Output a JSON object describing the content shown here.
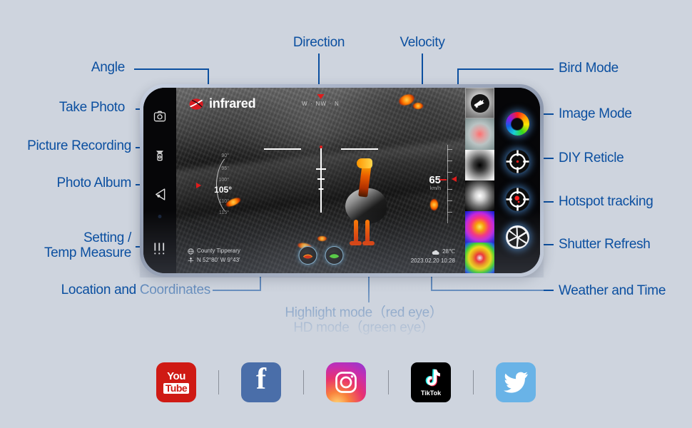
{
  "background_color": "#ced4de",
  "accent_color": "#0b4fa0",
  "annotations": {
    "left": [
      {
        "id": "angle",
        "label": "Angle"
      },
      {
        "id": "take-photo",
        "label": "Take Photo"
      },
      {
        "id": "picture-recording",
        "label": "Picture Recording"
      },
      {
        "id": "photo-album",
        "label": "Photo Album"
      },
      {
        "id": "setting-temp-line1",
        "label": "Setting /"
      },
      {
        "id": "setting-temp-line2",
        "label": "Temp Measure"
      },
      {
        "id": "location-coordinates",
        "label": "Location and Coordinates"
      }
    ],
    "top": [
      {
        "id": "direction",
        "label": "Direction"
      },
      {
        "id": "velocity",
        "label": "Velocity"
      }
    ],
    "right": [
      {
        "id": "bird-mode",
        "label": "Bird Mode"
      },
      {
        "id": "image-mode",
        "label": "Image Mode"
      },
      {
        "id": "diy-reticle",
        "label": "DIY Reticle"
      },
      {
        "id": "hotspot-tracking",
        "label": "Hotspot tracking"
      },
      {
        "id": "shutter-refresh",
        "label": "Shutter Refresh"
      },
      {
        "id": "weather-time",
        "label": "Weather and Time"
      }
    ],
    "bottom": [
      {
        "id": "highlight-mode",
        "label": "Highlight mode（red eye）"
      },
      {
        "id": "hd-mode",
        "label": "HD mode（green eye）"
      }
    ]
  },
  "screen": {
    "brand": "infrared",
    "compass": {
      "west": "W",
      "separator": "·",
      "current": "NW",
      "north": "N",
      "text": "W · NW · N"
    },
    "angle": {
      "ticks": [
        "90°",
        "95°",
        "100°",
        "110°",
        "115°"
      ],
      "current": "105°"
    },
    "velocity": {
      "value": "65",
      "unit": "km/h"
    },
    "location": {
      "place": "County Tipperary",
      "coordinates": "N 52°80′  W 9°43′"
    },
    "weather": {
      "temperature": "28℃",
      "datetime": "2023.02.20  10:28"
    },
    "left_buttons": [
      {
        "id": "take-photo",
        "icon": "camera-icon"
      },
      {
        "id": "picture-recording",
        "icon": "video-record-icon"
      },
      {
        "id": "photo-album",
        "icon": "photo-album-icon"
      },
      {
        "id": "setting-temp",
        "icon": "sliders-icon"
      }
    ],
    "right_buttons": [
      {
        "id": "image-mode",
        "icon": "color-wheel-icon"
      },
      {
        "id": "diy-reticle",
        "icon": "reticle-icon"
      },
      {
        "id": "hotspot-tracking",
        "icon": "hotspot-icon"
      },
      {
        "id": "shutter-refresh",
        "icon": "shutter-icon"
      }
    ],
    "palette_items": [
      {
        "id": "bird-mode",
        "selected": true
      },
      {
        "id": "palette-red-hot",
        "selected": false
      },
      {
        "id": "palette-black-hot",
        "selected": false
      },
      {
        "id": "palette-white-hot",
        "selected": false
      },
      {
        "id": "palette-fusion",
        "selected": false
      },
      {
        "id": "palette-rainbow",
        "selected": false
      }
    ],
    "eye_modes": [
      {
        "id": "highlight-mode",
        "color": "#ff7a00"
      },
      {
        "id": "hd-mode",
        "color": "#4cd430"
      }
    ]
  },
  "social": [
    {
      "id": "youtube",
      "line1": "You",
      "line2": "Tube"
    },
    {
      "id": "facebook",
      "glyph": "f"
    },
    {
      "id": "instagram",
      "glyph": ""
    },
    {
      "id": "tiktok",
      "label": "TikTok"
    },
    {
      "id": "twitter",
      "glyph": ""
    }
  ]
}
